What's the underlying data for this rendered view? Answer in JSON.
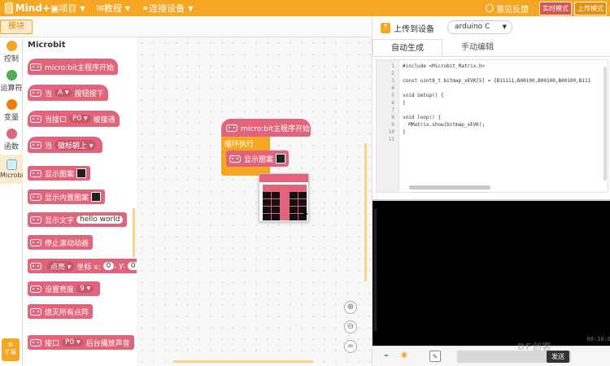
{
  "app": {
    "logo": "Mind+",
    "menu": [
      {
        "label": "项目"
      },
      {
        "label": "教程"
      },
      {
        "label": "连接设备"
      }
    ],
    "feedback": "意见反馈",
    "modes": [
      "实时模式",
      "上传模式"
    ]
  },
  "toolbar": {
    "module_tab": "模块"
  },
  "categories": [
    {
      "label": "控制",
      "color": "#f5a623"
    },
    {
      "label": "运算符",
      "color": "#4caf50"
    },
    {
      "label": "变量",
      "color": "#f57c00"
    },
    {
      "label": "函数",
      "color": "#e2647a"
    },
    {
      "label": "Microbit",
      "color": "#5fb3e0"
    }
  ],
  "expand_button": "扩展",
  "palette": {
    "title": "Microbit",
    "blocks": [
      {
        "label": "micro:bit主程序开始"
      },
      {
        "label": "当",
        "dropdown": "A",
        "suffix": "按钮按下"
      },
      {
        "label": "当接口",
        "dropdown": "P0",
        "suffix": "被接通"
      },
      {
        "label": "当",
        "dropdown": "徽标朝上"
      },
      {
        "label": "显示图案"
      },
      {
        "label": "显示内置图案"
      },
      {
        "label": "显示文字",
        "field": "hello world"
      },
      {
        "label": "停止滚动动画"
      },
      {
        "label": "点亮",
        "suffix": "坐标 x:",
        "field": "0",
        "suffix2": ", y:",
        "field2": "0"
      },
      {
        "label": "设置亮度",
        "dropdown": "9"
      },
      {
        "label": "熄灭所有点阵"
      },
      {
        "label": "接口",
        "dropdown": "P0",
        "suffix": "后台播放声音"
      }
    ]
  },
  "workspace": {
    "hat_label": "micro:bit主程序开始",
    "loop_label": "循环执行",
    "block_label": "显示图案",
    "matrix": [
      [
        1,
        1,
        1,
        1,
        1
      ],
      [
        0,
        0,
        1,
        0,
        0
      ],
      [
        0,
        0,
        1,
        0,
        0
      ],
      [
        0,
        0,
        1,
        0,
        0
      ],
      [
        0,
        0,
        1,
        0,
        0
      ]
    ],
    "matrix_on_color": "#e2647a",
    "matrix_off_color": "#111111",
    "zoom": [
      "zoom-in",
      "zoom-out",
      "zoom-reset"
    ]
  },
  "right_panel": {
    "upload_label": "上传到设备",
    "device": "arduino C",
    "tabs": [
      "自动生成",
      "手动编辑"
    ],
    "code_lines": [
      {
        "n": "1",
        "text": "#include <Microbit_Matrix.h>"
      },
      {
        "n": "2",
        "text": ""
      },
      {
        "n": "3",
        "text": "const uint8_t bitmap_xEVK[5] = {B11111,B00100,B00100,B00100,B111"
      },
      {
        "n": "4",
        "text": ""
      },
      {
        "n": "5",
        "text": "void setup() {"
      },
      {
        "n": "6",
        "text": "}"
      },
      {
        "n": "7",
        "text": ""
      },
      {
        "n": "8",
        "text": "void loop() {"
      },
      {
        "n": "9",
        "text": "  MMatrix.show(bitmap_xEVK);"
      },
      {
        "n": "10",
        "text": "}"
      },
      {
        "n": "11",
        "text": ""
      }
    ],
    "timestamp": "00:18:0",
    "send_label": "发送",
    "watermark": "DF创客"
  }
}
